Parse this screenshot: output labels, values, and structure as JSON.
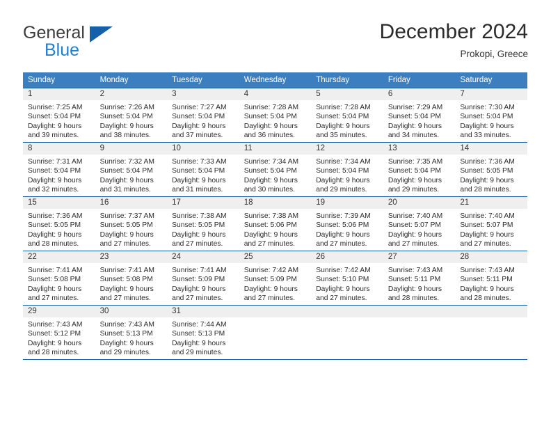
{
  "brand": {
    "name_part1": "General",
    "name_part2": "Blue",
    "logo_icon": "triangle-logo-icon"
  },
  "header": {
    "title": "December 2024",
    "location": "Prokopi, Greece"
  },
  "calendar": {
    "weekday_headers": [
      "Sunday",
      "Monday",
      "Tuesday",
      "Wednesday",
      "Thursday",
      "Friday",
      "Saturday"
    ],
    "accent_color": "#3c7fc0",
    "border_color": "#1560a8",
    "daynum_band_color": "#efefef",
    "weeks": [
      [
        {
          "day": "1",
          "sunrise": "Sunrise: 7:25 AM",
          "sunset": "Sunset: 5:04 PM",
          "daylight_line1": "Daylight: 9 hours",
          "daylight_line2": "and 39 minutes."
        },
        {
          "day": "2",
          "sunrise": "Sunrise: 7:26 AM",
          "sunset": "Sunset: 5:04 PM",
          "daylight_line1": "Daylight: 9 hours",
          "daylight_line2": "and 38 minutes."
        },
        {
          "day": "3",
          "sunrise": "Sunrise: 7:27 AM",
          "sunset": "Sunset: 5:04 PM",
          "daylight_line1": "Daylight: 9 hours",
          "daylight_line2": "and 37 minutes."
        },
        {
          "day": "4",
          "sunrise": "Sunrise: 7:28 AM",
          "sunset": "Sunset: 5:04 PM",
          "daylight_line1": "Daylight: 9 hours",
          "daylight_line2": "and 36 minutes."
        },
        {
          "day": "5",
          "sunrise": "Sunrise: 7:28 AM",
          "sunset": "Sunset: 5:04 PM",
          "daylight_line1": "Daylight: 9 hours",
          "daylight_line2": "and 35 minutes."
        },
        {
          "day": "6",
          "sunrise": "Sunrise: 7:29 AM",
          "sunset": "Sunset: 5:04 PM",
          "daylight_line1": "Daylight: 9 hours",
          "daylight_line2": "and 34 minutes."
        },
        {
          "day": "7",
          "sunrise": "Sunrise: 7:30 AM",
          "sunset": "Sunset: 5:04 PM",
          "daylight_line1": "Daylight: 9 hours",
          "daylight_line2": "and 33 minutes."
        }
      ],
      [
        {
          "day": "8",
          "sunrise": "Sunrise: 7:31 AM",
          "sunset": "Sunset: 5:04 PM",
          "daylight_line1": "Daylight: 9 hours",
          "daylight_line2": "and 32 minutes."
        },
        {
          "day": "9",
          "sunrise": "Sunrise: 7:32 AM",
          "sunset": "Sunset: 5:04 PM",
          "daylight_line1": "Daylight: 9 hours",
          "daylight_line2": "and 31 minutes."
        },
        {
          "day": "10",
          "sunrise": "Sunrise: 7:33 AM",
          "sunset": "Sunset: 5:04 PM",
          "daylight_line1": "Daylight: 9 hours",
          "daylight_line2": "and 31 minutes."
        },
        {
          "day": "11",
          "sunrise": "Sunrise: 7:34 AM",
          "sunset": "Sunset: 5:04 PM",
          "daylight_line1": "Daylight: 9 hours",
          "daylight_line2": "and 30 minutes."
        },
        {
          "day": "12",
          "sunrise": "Sunrise: 7:34 AM",
          "sunset": "Sunset: 5:04 PM",
          "daylight_line1": "Daylight: 9 hours",
          "daylight_line2": "and 29 minutes."
        },
        {
          "day": "13",
          "sunrise": "Sunrise: 7:35 AM",
          "sunset": "Sunset: 5:04 PM",
          "daylight_line1": "Daylight: 9 hours",
          "daylight_line2": "and 29 minutes."
        },
        {
          "day": "14",
          "sunrise": "Sunrise: 7:36 AM",
          "sunset": "Sunset: 5:05 PM",
          "daylight_line1": "Daylight: 9 hours",
          "daylight_line2": "and 28 minutes."
        }
      ],
      [
        {
          "day": "15",
          "sunrise": "Sunrise: 7:36 AM",
          "sunset": "Sunset: 5:05 PM",
          "daylight_line1": "Daylight: 9 hours",
          "daylight_line2": "and 28 minutes."
        },
        {
          "day": "16",
          "sunrise": "Sunrise: 7:37 AM",
          "sunset": "Sunset: 5:05 PM",
          "daylight_line1": "Daylight: 9 hours",
          "daylight_line2": "and 27 minutes."
        },
        {
          "day": "17",
          "sunrise": "Sunrise: 7:38 AM",
          "sunset": "Sunset: 5:05 PM",
          "daylight_line1": "Daylight: 9 hours",
          "daylight_line2": "and 27 minutes."
        },
        {
          "day": "18",
          "sunrise": "Sunrise: 7:38 AM",
          "sunset": "Sunset: 5:06 PM",
          "daylight_line1": "Daylight: 9 hours",
          "daylight_line2": "and 27 minutes."
        },
        {
          "day": "19",
          "sunrise": "Sunrise: 7:39 AM",
          "sunset": "Sunset: 5:06 PM",
          "daylight_line1": "Daylight: 9 hours",
          "daylight_line2": "and 27 minutes."
        },
        {
          "day": "20",
          "sunrise": "Sunrise: 7:40 AM",
          "sunset": "Sunset: 5:07 PM",
          "daylight_line1": "Daylight: 9 hours",
          "daylight_line2": "and 27 minutes."
        },
        {
          "day": "21",
          "sunrise": "Sunrise: 7:40 AM",
          "sunset": "Sunset: 5:07 PM",
          "daylight_line1": "Daylight: 9 hours",
          "daylight_line2": "and 27 minutes."
        }
      ],
      [
        {
          "day": "22",
          "sunrise": "Sunrise: 7:41 AM",
          "sunset": "Sunset: 5:08 PM",
          "daylight_line1": "Daylight: 9 hours",
          "daylight_line2": "and 27 minutes."
        },
        {
          "day": "23",
          "sunrise": "Sunrise: 7:41 AM",
          "sunset": "Sunset: 5:08 PM",
          "daylight_line1": "Daylight: 9 hours",
          "daylight_line2": "and 27 minutes."
        },
        {
          "day": "24",
          "sunrise": "Sunrise: 7:41 AM",
          "sunset": "Sunset: 5:09 PM",
          "daylight_line1": "Daylight: 9 hours",
          "daylight_line2": "and 27 minutes."
        },
        {
          "day": "25",
          "sunrise": "Sunrise: 7:42 AM",
          "sunset": "Sunset: 5:09 PM",
          "daylight_line1": "Daylight: 9 hours",
          "daylight_line2": "and 27 minutes."
        },
        {
          "day": "26",
          "sunrise": "Sunrise: 7:42 AM",
          "sunset": "Sunset: 5:10 PM",
          "daylight_line1": "Daylight: 9 hours",
          "daylight_line2": "and 27 minutes."
        },
        {
          "day": "27",
          "sunrise": "Sunrise: 7:43 AM",
          "sunset": "Sunset: 5:11 PM",
          "daylight_line1": "Daylight: 9 hours",
          "daylight_line2": "and 28 minutes."
        },
        {
          "day": "28",
          "sunrise": "Sunrise: 7:43 AM",
          "sunset": "Sunset: 5:11 PM",
          "daylight_line1": "Daylight: 9 hours",
          "daylight_line2": "and 28 minutes."
        }
      ],
      [
        {
          "day": "29",
          "sunrise": "Sunrise: 7:43 AM",
          "sunset": "Sunset: 5:12 PM",
          "daylight_line1": "Daylight: 9 hours",
          "daylight_line2": "and 28 minutes."
        },
        {
          "day": "30",
          "sunrise": "Sunrise: 7:43 AM",
          "sunset": "Sunset: 5:13 PM",
          "daylight_line1": "Daylight: 9 hours",
          "daylight_line2": "and 29 minutes."
        },
        {
          "day": "31",
          "sunrise": "Sunrise: 7:44 AM",
          "sunset": "Sunset: 5:13 PM",
          "daylight_line1": "Daylight: 9 hours",
          "daylight_line2": "and 29 minutes."
        },
        {
          "day": "",
          "sunrise": "",
          "sunset": "",
          "daylight_line1": "",
          "daylight_line2": ""
        },
        {
          "day": "",
          "sunrise": "",
          "sunset": "",
          "daylight_line1": "",
          "daylight_line2": ""
        },
        {
          "day": "",
          "sunrise": "",
          "sunset": "",
          "daylight_line1": "",
          "daylight_line2": ""
        },
        {
          "day": "",
          "sunrise": "",
          "sunset": "",
          "daylight_line1": "",
          "daylight_line2": ""
        }
      ]
    ]
  }
}
